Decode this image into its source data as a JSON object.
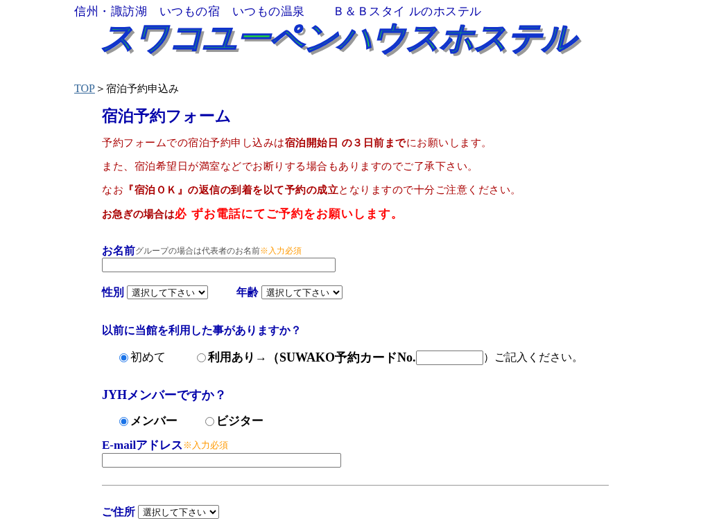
{
  "header": {
    "tagline": "信州・諏訪湖　いつもの宿　いつもの温泉　　 Ｂ＆Ｂスタイ ルのホステル",
    "logo": "スワコユーペンハウスホステル"
  },
  "breadcrumb": {
    "link": "TOP",
    "separator": "＞",
    "current": "宿泊予約申込み"
  },
  "form": {
    "title": "宿泊予約フォーム",
    "notes": [
      "予約フォームでの宿泊予約申し込みは**宿泊開始日 の３日前まで**にお願いします。",
      "また、宿泊希望日が満室などでお断りする場合もありますのでご了承下さい。",
      "なお**『宿泊ＯＫ』の返信の到着を以て予約の成立**となりますので十分ご注意ください。"
    ],
    "urgent": {
      "lead": "お急ぎの場合は",
      "emphasis": "必 ずお電話にてご予約をお願いします。"
    },
    "name": {
      "label": "お名前",
      "hint": "グループの場合は代表者のお名前",
      "required": "※入力必須"
    },
    "gender": {
      "label": "性別",
      "value": "選択して下さい"
    },
    "age": {
      "label": "年齢",
      "value": "選択して下さい"
    },
    "previous": {
      "question": "以前に当館を利用した事がありますか？",
      "options": [
        {
          "kind": "plain",
          "label": "初めて",
          "selected": true
        },
        {
          "kind": "card",
          "label": "利用あり→",
          "card_label": "（SUWAKO予約カードNo.",
          "suffix": "）ご記入ください。",
          "selected": false
        }
      ]
    },
    "member": {
      "question": "JYHメンバーですか？",
      "options": [
        {
          "kind": "bold",
          "label": "メンバー",
          "selected": true
        },
        {
          "kind": "bold",
          "label": "ビジター",
          "selected": false
        }
      ]
    },
    "email": {
      "label": "E-mailアドレス",
      "required": "※入力必須"
    },
    "address": {
      "label": "ご住所",
      "value": "選択して下さい"
    }
  }
}
